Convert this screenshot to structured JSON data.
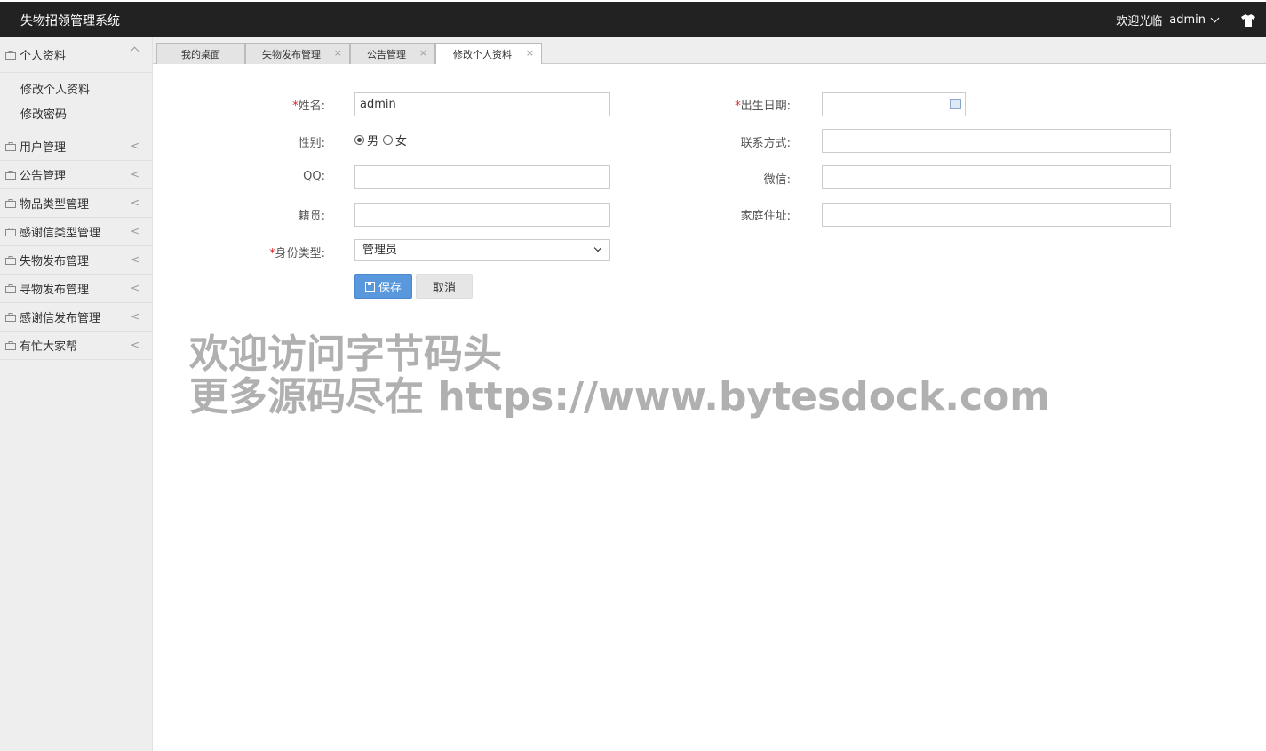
{
  "header": {
    "title": "失物招领管理系统",
    "welcome": "欢迎光临",
    "username": "admin"
  },
  "sidebar": {
    "items": [
      {
        "label": "个人资料",
        "expanded": true,
        "children": [
          "修改个人资料",
          "修改密码"
        ]
      },
      {
        "label": "用户管理"
      },
      {
        "label": "公告管理"
      },
      {
        "label": "物品类型管理"
      },
      {
        "label": "感谢信类型管理"
      },
      {
        "label": "失物发布管理"
      },
      {
        "label": "寻物发布管理"
      },
      {
        "label": "感谢信发布管理"
      },
      {
        "label": "有忙大家帮"
      }
    ]
  },
  "tabs": [
    {
      "label": "我的桌面"
    },
    {
      "label": "失物发布管理",
      "close": "×"
    },
    {
      "label": "公告管理",
      "close": "×"
    },
    {
      "label": "修改个人资料",
      "close": "×",
      "active": true
    }
  ],
  "form": {
    "required_mark": "*",
    "name_label": "姓名:",
    "name_value": "admin",
    "birth_label": "出生日期:",
    "birth_value": "",
    "gender_label": "性别:",
    "gender_male": "男",
    "gender_female": "女",
    "contact_label": "联系方式:",
    "qq_label": "QQ:",
    "wechat_label": "微信:",
    "hometown_label": "籍贯:",
    "address_label": "家庭住址:",
    "identity_label": "身份类型:",
    "identity_value": "管理员",
    "save_label": "保存",
    "cancel_label": "取消"
  },
  "watermark": {
    "line1": "欢迎访问字节码头",
    "line2": "更多源码尽在  https://www.bytesdock.com"
  }
}
